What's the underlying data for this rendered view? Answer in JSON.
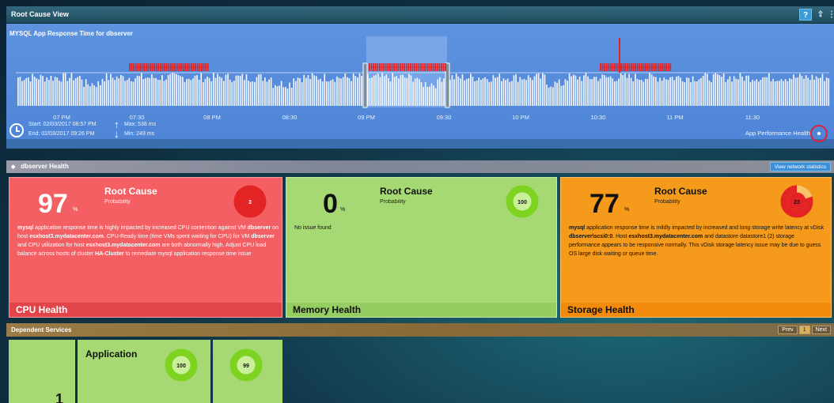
{
  "window": {
    "title": "Root Cause View",
    "help": "?",
    "export": "⇪",
    "more": "⋮"
  },
  "timeline": {
    "title": "MYSQL App Response Time for dbserver",
    "axis_labels": [
      "07 PM",
      "07:30",
      "08 PM",
      "08:30",
      "09 PM",
      "09:30",
      "10 PM",
      "10:30",
      "11 PM",
      "11:30"
    ],
    "start": "Start: 02/03/2017 08:57 PM",
    "end": "End: 02/03/2017 09:26 PM",
    "max": "Max: 538 ms",
    "min": "Min: 249 ms",
    "app_health_label": "App Performance Health"
  },
  "health": {
    "title": "dbserver Health",
    "view_network": "View network statistics",
    "cards": [
      {
        "value": "97",
        "unit": "%",
        "root_cause": "Root Cause",
        "probability": "Probability",
        "donut_value": "3",
        "description_parts": [
          {
            "t": "mysql",
            "b": true
          },
          {
            "t": " application response time is highly impacted by increased CPU contention against VM ",
            "b": false
          },
          {
            "t": "dbserver",
            "b": true
          },
          {
            "t": " on host ",
            "b": false
          },
          {
            "t": "esxhost3.mydatacenter.com",
            "b": true
          },
          {
            "t": ". CPU-Ready time (time VMs spent waiting for CPU) for VM ",
            "b": false
          },
          {
            "t": "dbserver",
            "b": true
          },
          {
            "t": " and CPU utilization for host ",
            "b": false
          },
          {
            "t": "esxhost3.mydatacenter.com",
            "b": true
          },
          {
            "t": " are both abnormally high. Adjust CPU load balance across hosts of cluster ",
            "b": false
          },
          {
            "t": "HA-Cluster",
            "b": true
          },
          {
            "t": " to remediate mysql application response time issue",
            "b": false
          }
        ],
        "footer": "CPU Health",
        "color": "#f45f64"
      },
      {
        "value": "0",
        "unit": "%",
        "root_cause": "Root Cause",
        "probability": "Probability",
        "donut_value": "100",
        "description": "No issue found",
        "footer": "Memory Health",
        "color": "#a6d974"
      },
      {
        "value": "77",
        "unit": "%",
        "root_cause": "Root Cause",
        "probability": "Probability",
        "donut_value": "23",
        "description_parts": [
          {
            "t": "mysql",
            "b": true
          },
          {
            "t": " application response time is mildly impacted by increased and long storage write latency at vDisk ",
            "b": false
          },
          {
            "t": "dbserver\\scsi0:0",
            "b": true
          },
          {
            "t": ". Host ",
            "b": false
          },
          {
            "t": "esxhost3.mydatacenter.com",
            "b": true
          },
          {
            "t": " and datastore datastore1 (2) storage performance appears to be responsive normally. This vDisk storage latency issue may be due to guess OS large disk waiting or queue time.",
            "b": false
          }
        ],
        "footer": "Storage Health",
        "color": "#f59a1a"
      }
    ]
  },
  "dependent": {
    "title": "Dependent Services",
    "prev": "Prev",
    "page": "1",
    "next": "Next",
    "card_title": "Application",
    "donut1": "100",
    "donut2": "99",
    "number": "1"
  },
  "colors": {
    "critical": "#e42424",
    "healthy": "#7ed321",
    "warning": "#f59a1a"
  }
}
